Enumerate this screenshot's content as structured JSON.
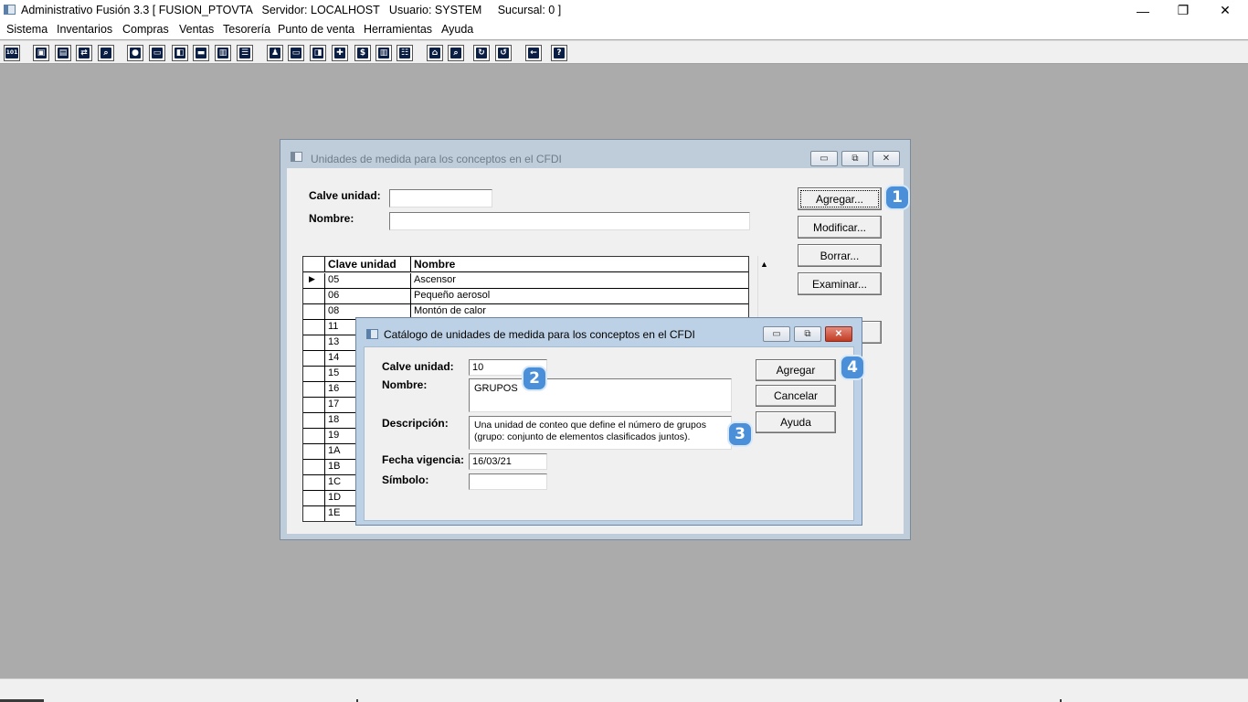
{
  "app": {
    "title": "Administrativo Fusión 3.3 [ FUSION_PTOVTA   Servidor: LOCALHOST   Usuario: SYSTEM     Sucursal: 0 ]",
    "controls": {
      "minimize": "—",
      "restore": "❐",
      "close": "✕"
    }
  },
  "menu": [
    "Sistema",
    "Inventarios",
    "Compras",
    "Ventas",
    "Tesorería",
    "Punto de venta",
    "Herramientas",
    "Ayuda"
  ],
  "toolbar_icons": [
    {
      "name": "calc-icon",
      "glyph": "101"
    },
    {
      "name": "copy-icon",
      "glyph": "▣"
    },
    {
      "name": "clipboard-icon",
      "glyph": "▤"
    },
    {
      "name": "transfer-icon",
      "glyph": "⇄"
    },
    {
      "name": "find-icon",
      "glyph": "⌕"
    },
    {
      "name": "user-icon",
      "glyph": "●"
    },
    {
      "name": "folder-icon",
      "glyph": "▭"
    },
    {
      "name": "import-icon",
      "glyph": "◧"
    },
    {
      "name": "print-icon",
      "glyph": "▬"
    },
    {
      "name": "document-icon",
      "glyph": "▥"
    },
    {
      "name": "list-icon",
      "glyph": "☰"
    },
    {
      "name": "users-icon",
      "glyph": "♟"
    },
    {
      "name": "card-icon",
      "glyph": "▭"
    },
    {
      "name": "export-icon",
      "glyph": "◨"
    },
    {
      "name": "add-icon",
      "glyph": "✚"
    },
    {
      "name": "dollar-icon",
      "glyph": "$"
    },
    {
      "name": "report-icon",
      "glyph": "▥"
    },
    {
      "name": "table-icon",
      "glyph": "☷"
    },
    {
      "name": "home-icon",
      "glyph": "⌂"
    },
    {
      "name": "search-icon",
      "glyph": "⌕"
    },
    {
      "name": "refresh-icon",
      "glyph": "↻"
    },
    {
      "name": "undo-icon",
      "glyph": "↺"
    },
    {
      "name": "back-icon",
      "glyph": "←"
    },
    {
      "name": "help-icon",
      "glyph": "?"
    }
  ],
  "back_window": {
    "title": "Unidades de medida para los conceptos en el CFDI",
    "labels": {
      "clave": "Calve unidad:",
      "nombre": "Nombre:"
    },
    "fields": {
      "clave": "",
      "nombre": ""
    },
    "buttons": [
      "Agregar...",
      "Modificar...",
      "Borrar...",
      "Examinar..."
    ],
    "grid": {
      "headers": [
        "Clave unidad",
        "Nombre"
      ],
      "row_indicator": "▶",
      "rows": [
        [
          "05",
          "Ascensor"
        ],
        [
          "06",
          "Pequeño aerosol"
        ],
        [
          "08",
          "Montón de calor"
        ],
        [
          "11",
          ""
        ],
        [
          "13",
          ""
        ],
        [
          "14",
          ""
        ],
        [
          "15",
          ""
        ],
        [
          "16",
          ""
        ],
        [
          "17",
          ""
        ],
        [
          "18",
          ""
        ],
        [
          "19",
          ""
        ],
        [
          "1A",
          ""
        ],
        [
          "1B",
          ""
        ],
        [
          "1C",
          ""
        ],
        [
          "1D",
          ""
        ],
        [
          "1E",
          ""
        ]
      ]
    }
  },
  "dialog": {
    "title": "Catálogo de unidades de medida para los conceptos en el CFDI",
    "labels": {
      "clave": "Calve unidad:",
      "nombre": "Nombre:",
      "descripcion": "Descripción:",
      "fecha": "Fecha vigencia:",
      "simbolo": "Símbolo:"
    },
    "fields": {
      "clave": "10",
      "nombre": "GRUPOS",
      "descripcion": "Una unidad de conteo que define el número de grupos (grupo: conjunto de elementos clasificados juntos).",
      "fecha": "16/03/21",
      "simbolo": ""
    },
    "buttons": {
      "agregar": "Agregar",
      "cancelar": "Cancelar",
      "ayuda": "Ayuda"
    }
  },
  "markers": [
    "1",
    "2",
    "3",
    "4"
  ],
  "colors": {
    "mdi_background": "#ababab",
    "marker": "#4a8fd8",
    "dialog_frame": "#bdd1e6"
  }
}
